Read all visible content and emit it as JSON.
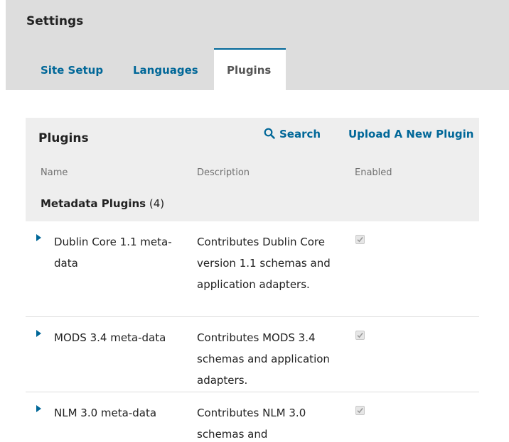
{
  "header": {
    "title": "Settings",
    "tabs": [
      {
        "label": "Site Setup",
        "active": false
      },
      {
        "label": "Languages",
        "active": false
      },
      {
        "label": "Plugins",
        "active": true
      }
    ]
  },
  "panel": {
    "title": "Plugins",
    "search_label": "Search",
    "upload_label": "Upload A New Plugin",
    "columns": {
      "name": "Name",
      "description": "Description",
      "enabled": "Enabled"
    },
    "category": {
      "name": "Metadata Plugins",
      "count": "(4)"
    },
    "rows": [
      {
        "name": "Dublin Core 1.1 meta-data",
        "description": "Contributes Dublin Core version 1.1 schemas and application adapters.",
        "enabled": true
      },
      {
        "name": "MODS 3.4 meta-data",
        "description": "Contributes MODS 3.4 schemas and application adapters.",
        "enabled": true
      },
      {
        "name": "NLM 3.0 meta-data",
        "description": "Contributes NLM 3.0 schemas and",
        "enabled": true
      }
    ]
  },
  "colors": {
    "accent": "#006798",
    "header_bg": "#dddddd",
    "panel_head_bg": "#eeeeee"
  },
  "icons": [
    "search-icon",
    "expand-arrow-icon",
    "checkmark-icon"
  ]
}
